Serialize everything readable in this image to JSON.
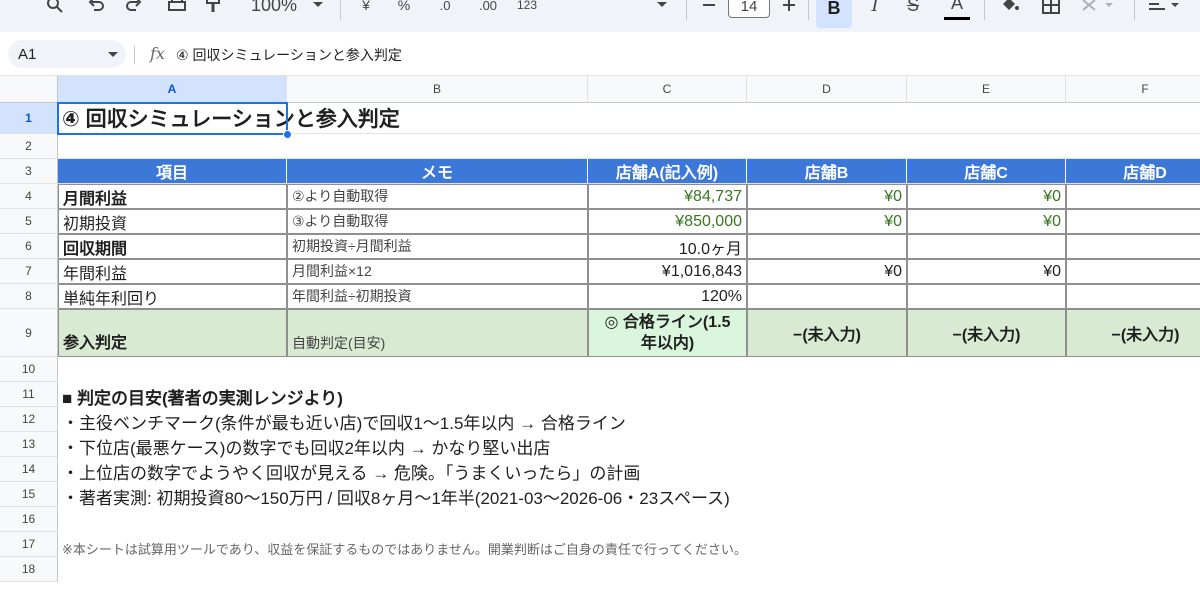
{
  "toolbar": {
    "zoom": "100%",
    "currency_label": "¥",
    "percent_label": "%",
    "decimal_decrease_label": ".0",
    "decimal_increase_label": ".00",
    "format_label": "123",
    "font_size": "14",
    "bold_label": "B",
    "italic_label": "I",
    "strike_label": "S",
    "text_color_label": "A",
    "icons": [
      "search-icon",
      "undo-icon",
      "redo-icon",
      "print-icon",
      "paint-format-icon",
      "zoom-dropdown-icon",
      "currency-icon",
      "percent-icon",
      "decimal-decrease-icon",
      "decimal-increase-icon",
      "number-format-icon",
      "font-dropdown-icon",
      "minus-icon",
      "plus-icon",
      "bold-icon",
      "italic-icon",
      "strikethrough-icon",
      "text-color-icon",
      "fill-color-icon",
      "borders-icon",
      "merge-cells-icon",
      "align-icon"
    ]
  },
  "formula_bar": {
    "cell_ref": "A1",
    "fx_label": "fx",
    "content": "④ 回収シミュレーションと参入判定"
  },
  "columns": [
    "A",
    "B",
    "C",
    "D",
    "E",
    "F"
  ],
  "rows": [
    "1",
    "2",
    "3",
    "4",
    "5",
    "6",
    "7",
    "8",
    "9",
    "10",
    "11",
    "12",
    "13",
    "14",
    "15",
    "16",
    "17",
    "18"
  ],
  "sheet": {
    "title": "④ 回収シミュレーションと参入判定",
    "headers": [
      "項目",
      "メモ",
      "店舗A(記入例)",
      "店舗B",
      "店舗C",
      "店舗D"
    ],
    "table": [
      {
        "item": "月間利益",
        "memo": "②より自動取得",
        "a": "¥84,737",
        "b": "¥0",
        "c": "¥0",
        "d": "",
        "bold": true
      },
      {
        "item": "初期投資",
        "memo": "③より自動取得",
        "a": "¥850,000",
        "b": "¥0",
        "c": "¥0",
        "d": "",
        "bold": false
      },
      {
        "item": "回収期間",
        "memo": "初期投資÷月間利益",
        "a": "10.0ヶ月",
        "b": "",
        "c": "",
        "d": "",
        "bold": true
      },
      {
        "item": "年間利益",
        "memo": "月間利益×12",
        "a": "¥1,016,843",
        "b": "¥0",
        "c": "¥0",
        "d": "",
        "bold": false
      },
      {
        "item": "単純年利回り",
        "memo": "年間利益÷初期投資",
        "a": "120%",
        "b": "",
        "c": "",
        "d": "",
        "bold": false
      }
    ],
    "judge": {
      "item": "参入判定",
      "memo": "自動判定(目安)",
      "a_line1": "◎ 合格ライン(1.5",
      "a_line2": "年以内)",
      "b": "−(未入力)",
      "c": "−(未入力)",
      "d": "−(未入力)"
    },
    "notes": [
      "■ 判定の目安(著者の実測レンジより)",
      "・主役ベンチマーク(条件が最も近い店)で回収1〜1.5年以内 → 合格ライン",
      "・下位店(最悪ケース)の数字でも回収2年以内 → かなり堅い出店",
      "・上位店の数字でようやく回収が見える → 危険。「うまくいったら」の計画",
      "・著者実測: 初期投資80〜150万円 / 回収8ヶ月〜1年半(2021-03〜2026-06・23スペース)"
    ],
    "disclaimer": "※本シートは試算用ツールであり、収益を保証するものではありません。開業判断はご自身の責任で行ってください。"
  },
  "colors": {
    "header_bg": "#3c78d8",
    "judge_bg": "#d9ead3",
    "positive_text": "#38761d",
    "selection": "#1a73e8"
  }
}
